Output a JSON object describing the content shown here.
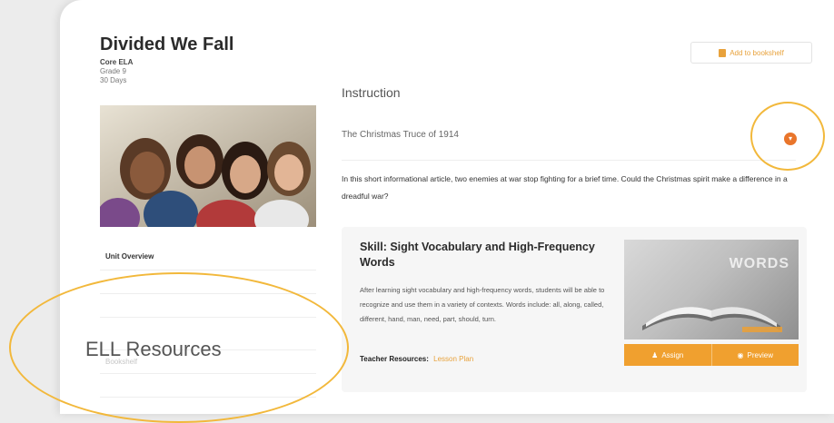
{
  "unit": {
    "title": "Divided We Fall",
    "program": "Core ELA",
    "grade": "Grade 9",
    "duration": "30 Days"
  },
  "header": {
    "add_to_bookshelf": "Add to bookshelf"
  },
  "sidebar": {
    "items": [
      {
        "label": "Unit Overview"
      },
      {
        "label": ""
      },
      {
        "label": ""
      },
      {
        "label": "Bookshelf"
      },
      {
        "label": ""
      }
    ]
  },
  "main": {
    "section_heading": "Instruction",
    "item_title": "The Christmas Truce of 1914",
    "item_description": "In this short informational article, two enemies at war stop fighting for a brief time. Could the Christmas spirit make a difference in a dreadful war?",
    "skill": {
      "title": "Skill: Sight Vocabulary and High-Frequency Words",
      "description": "After learning sight vocabulary and high-frequency words, students will be able to recognize and use them in a variety of contexts. Words include: all, along, called, different, hand, man, need, part, should, turn.",
      "resources_label": "Teacher Resources:",
      "resources_link": "Lesson Plan",
      "assign_label": "Assign",
      "preview_label": "Preview",
      "cover_text": "WORDS"
    }
  },
  "annotation": {
    "ell_label": "ELL Resources",
    "highlight_color": "#f2b83b"
  },
  "colors": {
    "accent": "#f0a02f",
    "toggle": "#e9752b"
  }
}
